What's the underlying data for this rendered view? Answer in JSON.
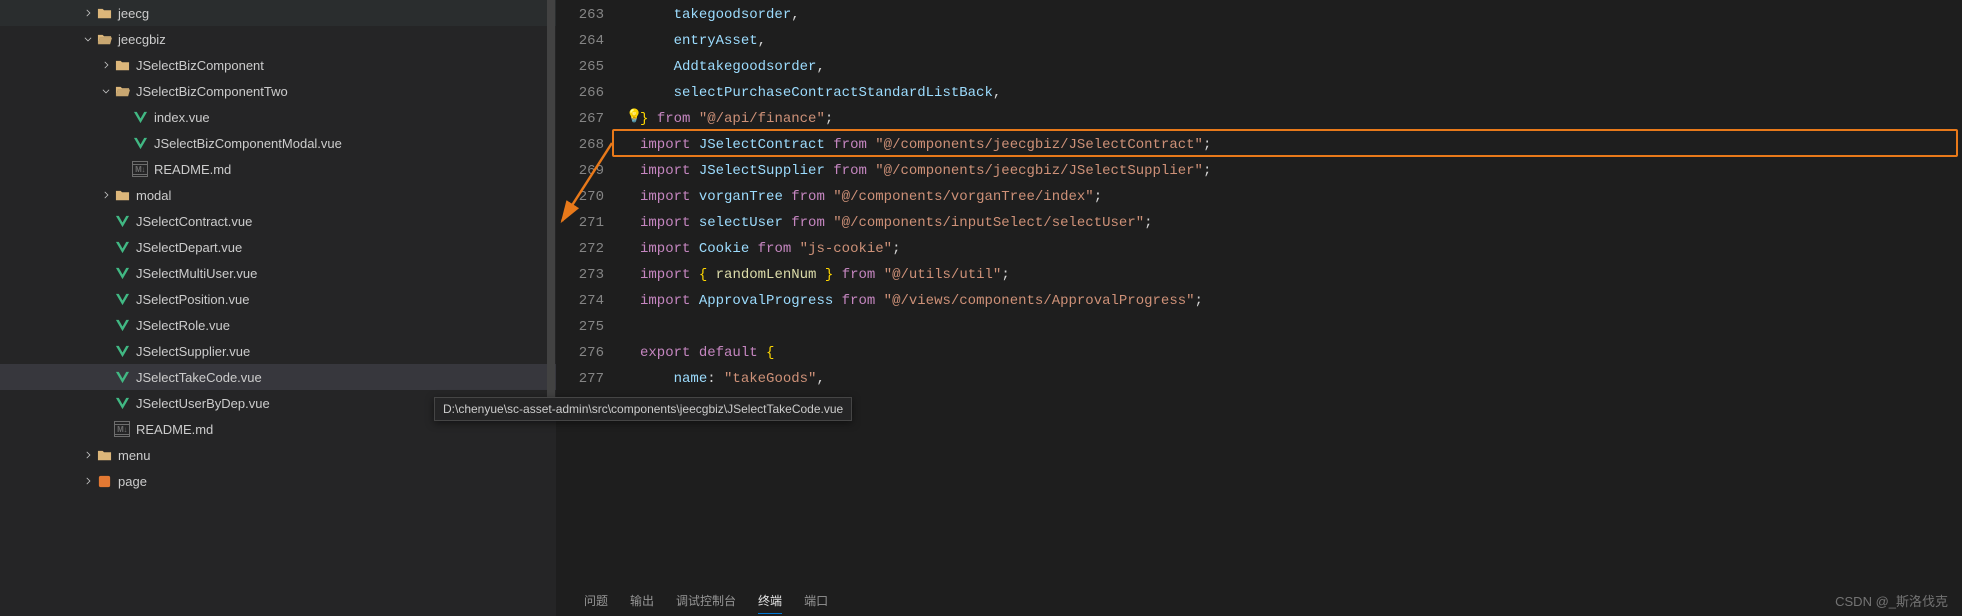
{
  "sidebar": {
    "items": [
      {
        "depth": 4,
        "kind": "folder",
        "chevron": "right",
        "label": "jeecg"
      },
      {
        "depth": 4,
        "kind": "folder-open",
        "chevron": "down",
        "label": "jeecgbiz"
      },
      {
        "depth": 5,
        "kind": "folder",
        "chevron": "right",
        "label": "JSelectBizComponent"
      },
      {
        "depth": 5,
        "kind": "folder-open",
        "chevron": "down",
        "label": "JSelectBizComponentTwo"
      },
      {
        "depth": 6,
        "kind": "vue",
        "chevron": "",
        "label": "index.vue"
      },
      {
        "depth": 6,
        "kind": "vue",
        "chevron": "",
        "label": "JSelectBizComponentModal.vue"
      },
      {
        "depth": 6,
        "kind": "md",
        "chevron": "",
        "label": "README.md"
      },
      {
        "depth": 5,
        "kind": "folder",
        "chevron": "right",
        "label": "modal"
      },
      {
        "depth": 5,
        "kind": "vue",
        "chevron": "",
        "label": "JSelectContract.vue",
        "target": true
      },
      {
        "depth": 5,
        "kind": "vue",
        "chevron": "",
        "label": "JSelectDepart.vue"
      },
      {
        "depth": 5,
        "kind": "vue",
        "chevron": "",
        "label": "JSelectMultiUser.vue"
      },
      {
        "depth": 5,
        "kind": "vue",
        "chevron": "",
        "label": "JSelectPosition.vue"
      },
      {
        "depth": 5,
        "kind": "vue",
        "chevron": "",
        "label": "JSelectRole.vue"
      },
      {
        "depth": 5,
        "kind": "vue",
        "chevron": "",
        "label": "JSelectSupplier.vue"
      },
      {
        "depth": 5,
        "kind": "vue",
        "chevron": "",
        "label": "JSelectTakeCode.vue",
        "selected": true
      },
      {
        "depth": 5,
        "kind": "vue",
        "chevron": "",
        "label": "JSelectUserByDep.vue"
      },
      {
        "depth": 5,
        "kind": "md",
        "chevron": "",
        "label": "README.md"
      },
      {
        "depth": 4,
        "kind": "folder",
        "chevron": "right",
        "label": "menu"
      },
      {
        "depth": 4,
        "kind": "page",
        "chevron": "right",
        "label": "page"
      }
    ]
  },
  "tooltip": "D:\\chenyue\\sc-asset-admin\\src\\components\\jeecgbiz\\JSelectTakeCode.vue",
  "editor": {
    "first_line_number": 263,
    "lines": [
      {
        "indent": 2,
        "tokens": [
          {
            "c": "ident",
            "t": "takegoodsorder"
          },
          {
            "c": "punct",
            "t": ","
          }
        ]
      },
      {
        "indent": 2,
        "tokens": [
          {
            "c": "ident",
            "t": "entryAsset"
          },
          {
            "c": "punct",
            "t": ","
          }
        ]
      },
      {
        "indent": 2,
        "tokens": [
          {
            "c": "ident",
            "t": "Addtakegoodsorder"
          },
          {
            "c": "punct",
            "t": ","
          }
        ]
      },
      {
        "indent": 2,
        "tokens": [
          {
            "c": "ident",
            "t": "selectPurchaseContractStandardListBack"
          },
          {
            "c": "punct",
            "t": ","
          }
        ]
      },
      {
        "indent": 0,
        "tokens": [
          {
            "c": "brace",
            "t": "}"
          },
          {
            "c": "punct",
            "t": " "
          },
          {
            "c": "keyword",
            "t": "from"
          },
          {
            "c": "punct",
            "t": " "
          },
          {
            "c": "string",
            "t": "\"@/api/finance\""
          },
          {
            "c": "punct",
            "t": ";"
          }
        ]
      },
      {
        "indent": 0,
        "hl": true,
        "tokens": [
          {
            "c": "keyword",
            "t": "import"
          },
          {
            "c": "punct",
            "t": " "
          },
          {
            "c": "ident",
            "t": "JSelectContract"
          },
          {
            "c": "punct",
            "t": " "
          },
          {
            "c": "keyword",
            "t": "from"
          },
          {
            "c": "punct",
            "t": " "
          },
          {
            "c": "string",
            "t": "\"@/components/jeecgbiz/JSelectContract\""
          },
          {
            "c": "punct",
            "t": ";"
          }
        ]
      },
      {
        "indent": 0,
        "tokens": [
          {
            "c": "keyword",
            "t": "import"
          },
          {
            "c": "punct",
            "t": " "
          },
          {
            "c": "ident",
            "t": "JSelectSupplier"
          },
          {
            "c": "punct",
            "t": " "
          },
          {
            "c": "keyword",
            "t": "from"
          },
          {
            "c": "punct",
            "t": " "
          },
          {
            "c": "string",
            "t": "\"@/components/jeecgbiz/JSelectSupplier\""
          },
          {
            "c": "punct",
            "t": ";"
          }
        ]
      },
      {
        "indent": 0,
        "tokens": [
          {
            "c": "keyword",
            "t": "import"
          },
          {
            "c": "punct",
            "t": " "
          },
          {
            "c": "ident",
            "t": "vorganTree"
          },
          {
            "c": "punct",
            "t": " "
          },
          {
            "c": "keyword",
            "t": "from"
          },
          {
            "c": "punct",
            "t": " "
          },
          {
            "c": "string",
            "t": "\"@/components/vorganTree/index\""
          },
          {
            "c": "punct",
            "t": ";"
          }
        ]
      },
      {
        "indent": 0,
        "tokens": [
          {
            "c": "keyword",
            "t": "import"
          },
          {
            "c": "punct",
            "t": " "
          },
          {
            "c": "ident",
            "t": "selectUser"
          },
          {
            "c": "punct",
            "t": " "
          },
          {
            "c": "keyword",
            "t": "from"
          },
          {
            "c": "punct",
            "t": " "
          },
          {
            "c": "string",
            "t": "\"@/components/inputSelect/selectUser\""
          },
          {
            "c": "punct",
            "t": ";"
          }
        ]
      },
      {
        "indent": 0,
        "tokens": [
          {
            "c": "keyword",
            "t": "import"
          },
          {
            "c": "punct",
            "t": " "
          },
          {
            "c": "ident",
            "t": "Cookie"
          },
          {
            "c": "punct",
            "t": " "
          },
          {
            "c": "keyword",
            "t": "from"
          },
          {
            "c": "punct",
            "t": " "
          },
          {
            "c": "string",
            "t": "\"js-cookie\""
          },
          {
            "c": "punct",
            "t": ";"
          }
        ]
      },
      {
        "indent": 0,
        "tokens": [
          {
            "c": "keyword",
            "t": "import"
          },
          {
            "c": "punct",
            "t": " "
          },
          {
            "c": "brace",
            "t": "{"
          },
          {
            "c": "punct",
            "t": " "
          },
          {
            "c": "func",
            "t": "randomLenNum"
          },
          {
            "c": "punct",
            "t": " "
          },
          {
            "c": "brace",
            "t": "}"
          },
          {
            "c": "punct",
            "t": " "
          },
          {
            "c": "keyword",
            "t": "from"
          },
          {
            "c": "punct",
            "t": " "
          },
          {
            "c": "string",
            "t": "\"@/utils/util\""
          },
          {
            "c": "punct",
            "t": ";"
          }
        ]
      },
      {
        "indent": 0,
        "tokens": [
          {
            "c": "keyword",
            "t": "import"
          },
          {
            "c": "punct",
            "t": " "
          },
          {
            "c": "ident",
            "t": "ApprovalProgress"
          },
          {
            "c": "punct",
            "t": " "
          },
          {
            "c": "keyword",
            "t": "from"
          },
          {
            "c": "punct",
            "t": " "
          },
          {
            "c": "string",
            "t": "\"@/views/components/ApprovalProgress\""
          },
          {
            "c": "punct",
            "t": ";"
          }
        ]
      },
      {
        "indent": 0,
        "tokens": []
      },
      {
        "indent": 0,
        "tokens": [
          {
            "c": "keyword",
            "t": "export"
          },
          {
            "c": "punct",
            "t": " "
          },
          {
            "c": "keyword",
            "t": "default"
          },
          {
            "c": "punct",
            "t": " "
          },
          {
            "c": "brace",
            "t": "{"
          }
        ]
      },
      {
        "indent": 2,
        "tokens": [
          {
            "c": "ident",
            "t": "name"
          },
          {
            "c": "punct",
            "t": ": "
          },
          {
            "c": "string",
            "t": "\"takeGoods\""
          },
          {
            "c": "punct",
            "t": ","
          }
        ]
      }
    ]
  },
  "panel": {
    "tabs": [
      {
        "label": "问题",
        "active": false
      },
      {
        "label": "输出",
        "active": false
      },
      {
        "label": "调试控制台",
        "active": false
      },
      {
        "label": "终端",
        "active": true
      },
      {
        "label": "端口",
        "active": false
      }
    ]
  },
  "watermark": "CSDN @_斯洛伐克"
}
